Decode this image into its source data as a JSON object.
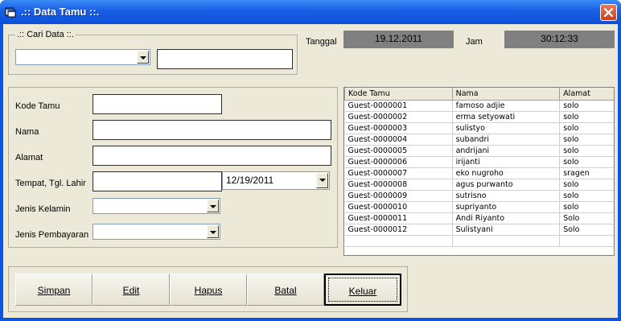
{
  "window": {
    "title": ".:: Data Tamu ::.",
    "close_icon": "close-icon",
    "app_icon": "app-window-icon"
  },
  "search": {
    "caption": ".:: Cari Data ::.",
    "combo_value": "",
    "text_value": ""
  },
  "header": {
    "date_label": "Tanggal",
    "date_value": "19.12.2011",
    "time_label": "Jam",
    "time_value": "30:12:33"
  },
  "form": {
    "kode_label": "Kode Tamu",
    "nama_label": "Nama",
    "alamat_label": "Alamat",
    "ttl_label": "Tempat, Tgl. Lahir",
    "date_picker_value": "12/19/2011",
    "jk_label": "Jenis Kelamin",
    "jp_label": "Jenis Pembayaran"
  },
  "table": {
    "columns": [
      "Kode Tamu",
      "Nama",
      "Alamat"
    ],
    "rows": [
      [
        "Guest-0000001",
        "famoso adjie",
        "solo"
      ],
      [
        "Guest-0000002",
        "erma setyowati",
        "solo"
      ],
      [
        "Guest-0000003",
        "sulistyo",
        "solo"
      ],
      [
        "Guest-0000004",
        "subandri",
        "solo"
      ],
      [
        "Guest-0000005",
        "andrijani",
        "solo"
      ],
      [
        "Guest-0000006",
        "irijanti",
        "solo"
      ],
      [
        "Guest-0000007",
        "eko nugroho",
        "sragen"
      ],
      [
        "Guest-0000008",
        "agus purwanto",
        "solo"
      ],
      [
        "Guest-0000009",
        "sutrisno",
        "solo"
      ],
      [
        "Guest-0000010",
        "supriyanto",
        "solo"
      ],
      [
        "Guest-0000011",
        "Andi Riyanto",
        "Solo"
      ],
      [
        "Guest-0000012",
        "Sulistyani",
        "Solo"
      ]
    ]
  },
  "buttons": {
    "simpan": "Simpan",
    "edit": "Edit",
    "hapus": "Hapus",
    "batal": "Batal",
    "keluar": "Keluar"
  },
  "colors": {
    "titlebar": "#0a55e6",
    "client": "#ece9d8",
    "datebox": "#808080"
  }
}
